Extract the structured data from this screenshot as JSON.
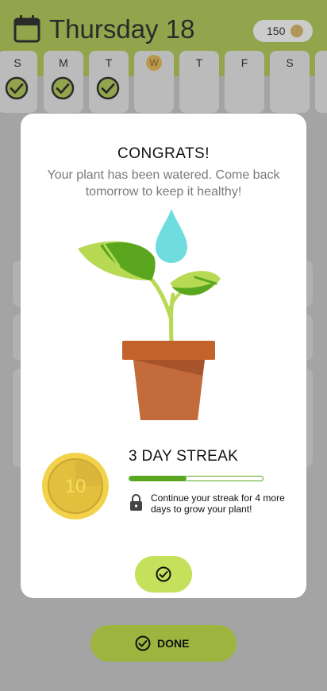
{
  "header": {
    "date_title": "Thursday 18",
    "coins": "150",
    "calendar_icon": "calendar-icon",
    "coin_icon": "coin-icon"
  },
  "week": {
    "days": [
      {
        "label": "S",
        "completed": true,
        "today": false
      },
      {
        "label": "M",
        "completed": true,
        "today": false
      },
      {
        "label": "T",
        "completed": true,
        "today": false
      },
      {
        "label": "W",
        "completed": false,
        "today": true
      },
      {
        "label": "T",
        "completed": false,
        "today": false
      },
      {
        "label": "F",
        "completed": false,
        "today": false
      },
      {
        "label": "S",
        "completed": false,
        "today": false
      }
    ]
  },
  "modal": {
    "title": "CONGRATS!",
    "message": "Your plant has been watered. Come back tomorrow to keep it healthy!",
    "badge_value": "10",
    "streak_title": "3 DAY STREAK",
    "streak_progress": 0.43,
    "streak_hint": "Continue your streak for 4 more days to grow your plant!",
    "confirm_icon": "check-circle-icon"
  },
  "footer": {
    "done_label": "DONE",
    "done_icon": "check-circle-icon"
  },
  "colors": {
    "accent": "#9db53e",
    "confirm": "#c5e05a",
    "progress": "#5aa61f",
    "coin": "#e4c13b"
  }
}
